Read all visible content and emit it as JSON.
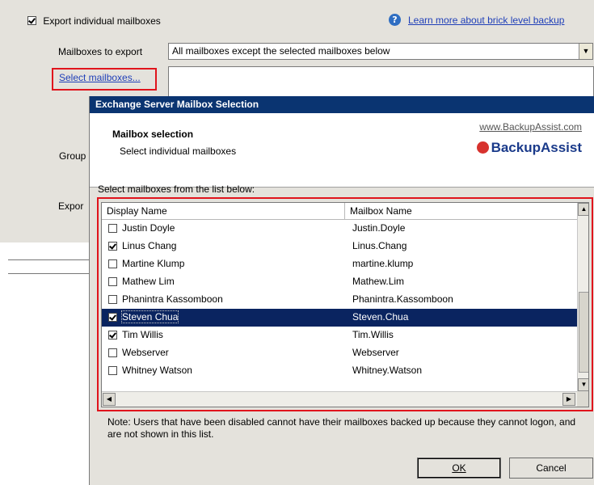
{
  "background": {
    "export_individual": {
      "label": "Export individual mailboxes",
      "checked": true
    },
    "learn_more_link": "Learn more about brick level backup",
    "mailboxes_to_export_label": "Mailboxes to export",
    "mailboxes_to_export_value": "All mailboxes except the selected mailboxes below",
    "select_mailboxes_link": "Select mailboxes...",
    "group_label_partial": "Group",
    "export_label_partial": "Expor"
  },
  "dialog": {
    "title": "Exchange Server Mailbox Selection",
    "header_title": "Mailbox selection",
    "header_subtitle": "Select individual mailboxes",
    "brand_url": "www.BackupAssist.com",
    "brand_name": "BackupAssist",
    "instruction": "Select mailboxes from the list below:",
    "columns": {
      "display_name": "Display Name",
      "mailbox_name": "Mailbox Name"
    },
    "rows": [
      {
        "display": "Justin Doyle",
        "mailbox": "Justin.Doyle",
        "checked": false,
        "selected": false
      },
      {
        "display": "Linus Chang",
        "mailbox": "Linus.Chang",
        "checked": true,
        "selected": false
      },
      {
        "display": "Martine Klump",
        "mailbox": "martine.klump",
        "checked": false,
        "selected": false
      },
      {
        "display": "Mathew Lim",
        "mailbox": "Mathew.Lim",
        "checked": false,
        "selected": false
      },
      {
        "display": "Phanintra Kassomboon",
        "mailbox": "Phanintra.Kassomboon",
        "checked": false,
        "selected": false
      },
      {
        "display": "Steven Chua",
        "mailbox": "Steven.Chua",
        "checked": true,
        "selected": true
      },
      {
        "display": "Tim Willis",
        "mailbox": "Tim.Willis",
        "checked": true,
        "selected": false
      },
      {
        "display": "Webserver",
        "mailbox": "Webserver",
        "checked": false,
        "selected": false
      },
      {
        "display": "Whitney Watson",
        "mailbox": "Whitney.Watson",
        "checked": false,
        "selected": false
      }
    ],
    "note": "Note: Users that have been disabled cannot have their mailboxes backed up because they cannot logon, and are not shown in this list.",
    "ok_label": "OK",
    "cancel_label": "Cancel"
  },
  "colors": {
    "highlight_red": "#e0141c",
    "title_bar": "#0a3471",
    "selected_row": "#0a2460",
    "link": "#1f3fb8"
  }
}
